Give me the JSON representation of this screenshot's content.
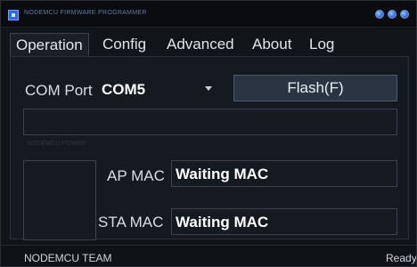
{
  "window": {
    "title": "NODEMCU FIRMWARE PROGRAMMER",
    "icons": {
      "app": "app-icon",
      "minimize": "minimize-icon",
      "maximize": "maximize-icon",
      "close": "close-icon"
    }
  },
  "tabs": [
    {
      "label": "Operation",
      "active": true
    },
    {
      "label": "Config",
      "active": false
    },
    {
      "label": "Advanced",
      "active": false
    },
    {
      "label": "About",
      "active": false
    },
    {
      "label": "Log",
      "active": false
    }
  ],
  "operation": {
    "com_port_label": "COM Port",
    "com_port_value": "COM5",
    "flash_label": "Flash(F)",
    "progress_text": "",
    "faint_text": "NODEMCU POWER",
    "ap_mac_label": "AP MAC",
    "ap_mac_value": "Waiting MAC",
    "sta_mac_label": "STA MAC",
    "sta_mac_value": "Waiting MAC"
  },
  "status": {
    "left": "NODEMCU TEAM",
    "right": "Ready"
  },
  "colors": {
    "accent_blue": "#2b6de0",
    "panel_bg": "#151a20",
    "border": "#3b4350"
  }
}
